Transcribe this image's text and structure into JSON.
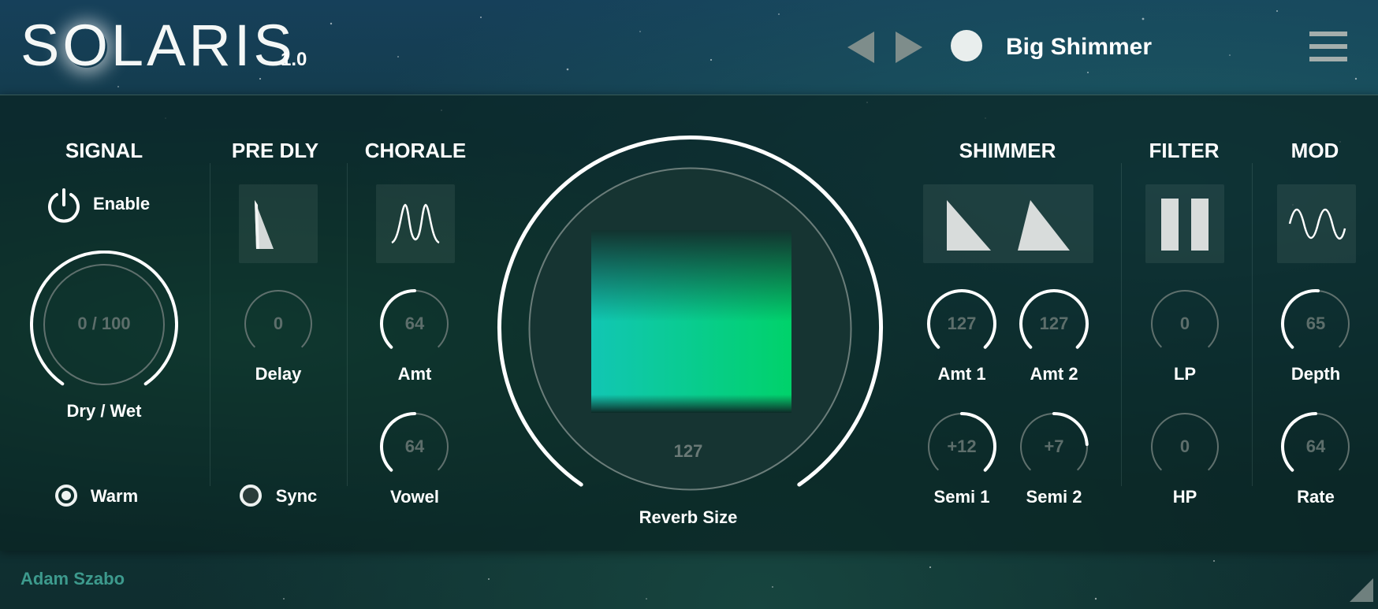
{
  "header": {
    "logo_text": "SOLARIS",
    "version": "1.0",
    "preset_name": "Big Shimmer"
  },
  "sections": {
    "signal": "SIGNAL",
    "pre_dly": "PRE DLY",
    "chorale": "CHORALE",
    "shimmer": "SHIMMER",
    "filter": "FILTER",
    "mod": "MOD"
  },
  "signal": {
    "enable_label": "Enable",
    "drywet_value": "0 / 100",
    "drywet_label": "Dry / Wet",
    "warm_label": "Warm"
  },
  "predly": {
    "delay_value": "0",
    "delay_label": "Delay",
    "sync_label": "Sync"
  },
  "chorale": {
    "amt_value": "64",
    "amt_label": "Amt",
    "vowel_value": "64",
    "vowel_label": "Vowel"
  },
  "reverb": {
    "value": "127",
    "label": "Reverb Size"
  },
  "shimmer": {
    "amt1_value": "127",
    "amt1_label": "Amt 1",
    "amt2_value": "127",
    "amt2_label": "Amt 2",
    "semi1_value": "+12",
    "semi1_label": "Semi 1",
    "semi2_value": "+7",
    "semi2_label": "Semi 2"
  },
  "filter": {
    "lp_value": "0",
    "lp_label": "LP",
    "hp_value": "0",
    "hp_label": "HP"
  },
  "mod": {
    "depth_value": "65",
    "depth_label": "Depth",
    "rate_value": "64",
    "rate_label": "Rate"
  },
  "footer": {
    "author": "Adam Szabo"
  },
  "colors": {
    "accent_green": "#00d26a",
    "accent_teal": "#12c6b4",
    "knob_track": "#5f706d",
    "knob_arc": "#ffffff"
  }
}
